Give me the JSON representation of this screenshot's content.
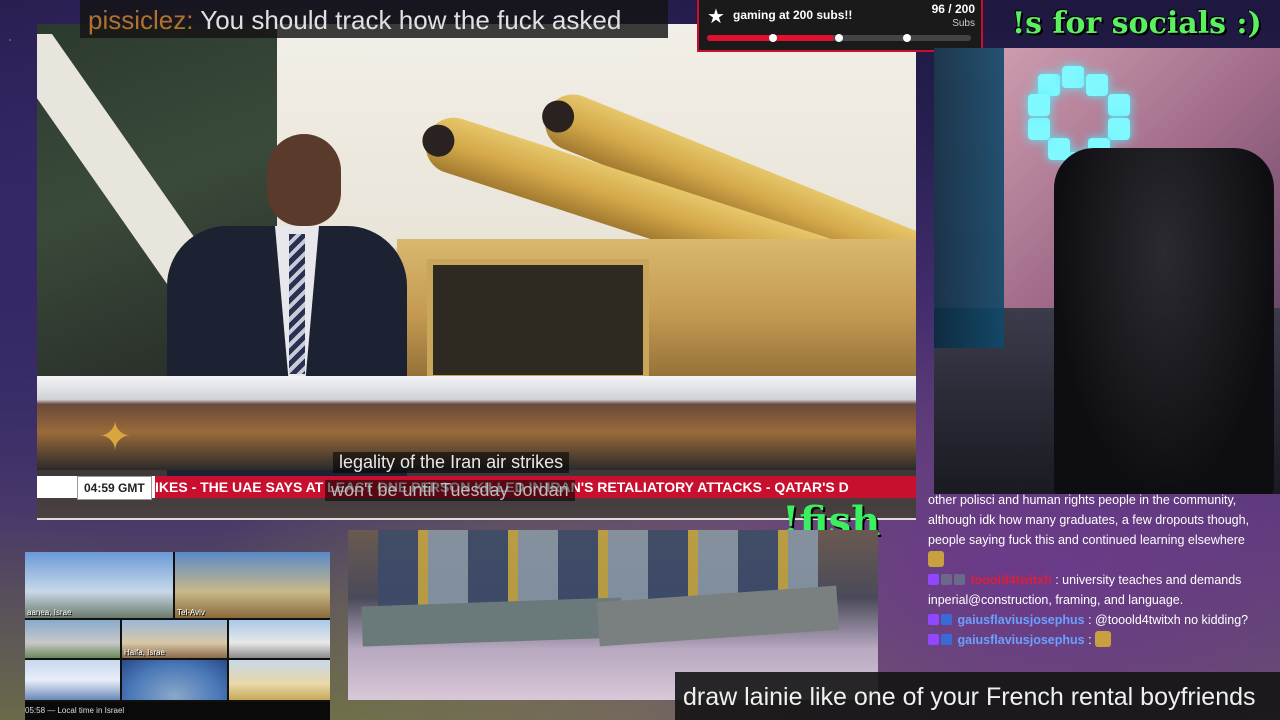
{
  "chat_overlay": {
    "username": "pissiclez:",
    "message": " You should track how the fuck asked"
  },
  "sub_goal": {
    "title": "gaming at 200 subs!!",
    "count": "96 / 200",
    "unit": "Subs",
    "progress": 0.48,
    "accent_color": "#e01030"
  },
  "socials_label": "!s for socials :)",
  "news": {
    "clock": "04:59  GMT",
    "ticker": "IKES  -  THE UAE SAYS AT LEAST ONE PERSON KILLED IN IRAN'S RETALIATORY ATTACKS  -  QATAR'S D",
    "caption_line1": "legality of the Iran air strikes",
    "caption_line2": "won't be until Tuesday Jordan",
    "ticker_color": "#c8102e",
    "logo_icon": "aljazeera-logo"
  },
  "fish_label": "!fish",
  "chat_panel": {
    "lines": [
      {
        "text": "other polisci and human rights people in the community,"
      },
      {
        "text": "although idk how many graduates, a few dropouts though,"
      },
      {
        "text": "people saying fuck this and continued learning elsewhere"
      },
      {
        "user": "tooold4twitxh",
        "text": ": university teaches and demands"
      },
      {
        "text": "inperial@construction, framing, and language."
      },
      {
        "user": "gaiusflaviusjosephus",
        "text": ": @tooold4twitxh no kidding?"
      },
      {
        "user": "gaiusflaviusjosephus",
        "text": ":"
      }
    ]
  },
  "cam_grid": {
    "labels": [
      "aanea, Israe",
      "Tel-Aviv",
      "",
      "Haifa, Israe",
      "",
      "",
      "",
      "",
      ""
    ],
    "footer_time": "05:58",
    "footer_text": "Local time in Israel"
  },
  "bottom_message": "draw lainie like one of your French rental boyfriends"
}
